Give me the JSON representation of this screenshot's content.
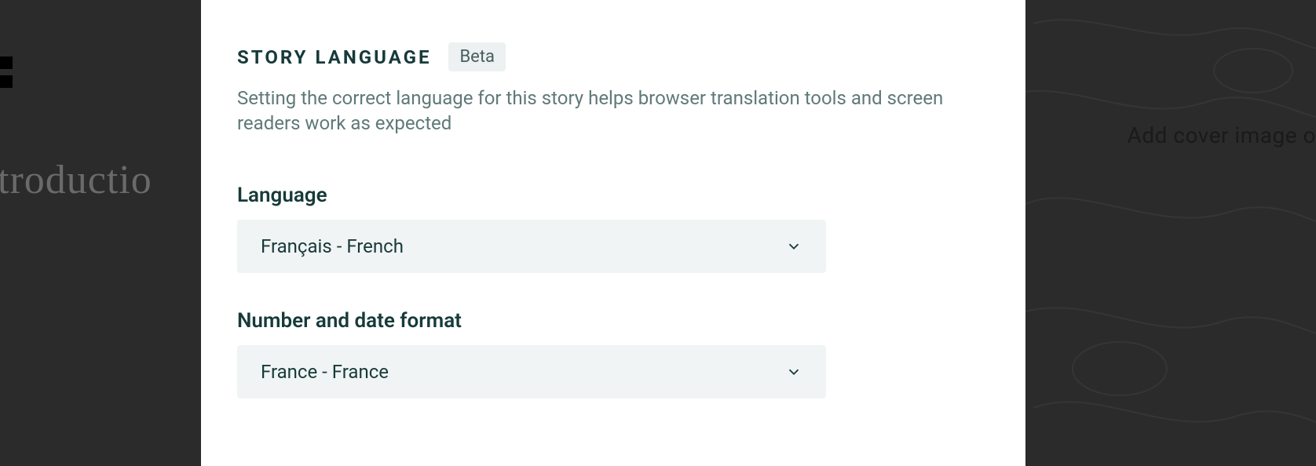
{
  "backdrop": {
    "left_partial_text": "ntroductio",
    "right_partial_text": "Add cover image or"
  },
  "section": {
    "title": "STORY LANGUAGE",
    "badge": "Beta",
    "description": "Setting the correct language for this story helps browser translation tools and screen readers work as expected"
  },
  "fields": {
    "language": {
      "label": "Language",
      "value": "Français - French"
    },
    "format": {
      "label": "Number and date format",
      "value": "France - France"
    }
  }
}
